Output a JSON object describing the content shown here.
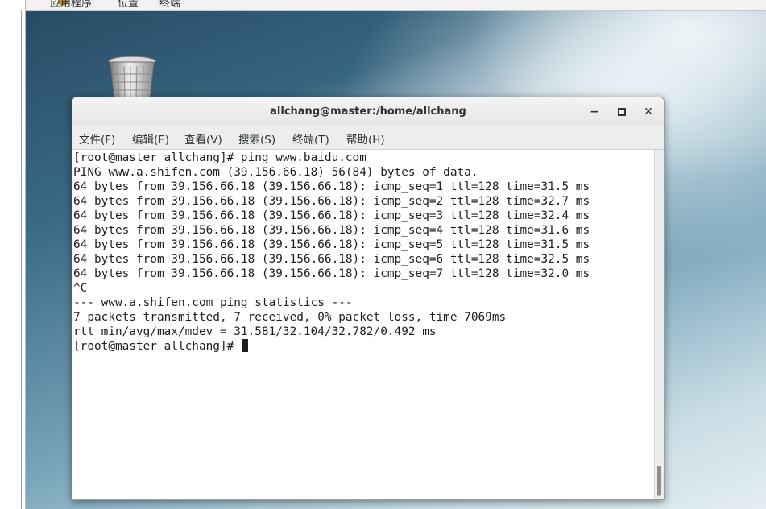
{
  "top_panel": {
    "applications": "应用程序",
    "places": "位置",
    "terminal": "终端"
  },
  "terminal": {
    "title": "allchang@master:/home/allchang",
    "controls": {
      "minimize": "−",
      "maximize": "▫",
      "close": "✕"
    },
    "menu": [
      "文件(F)",
      "编辑(E)",
      "查看(V)",
      "搜索(S)",
      "终端(T)",
      "帮助(H)"
    ],
    "lines": [
      "[root@master allchang]# ping www.baidu.com",
      "PING www.a.shifen.com (39.156.66.18) 56(84) bytes of data.",
      "64 bytes from 39.156.66.18 (39.156.66.18): icmp_seq=1 ttl=128 time=31.5 ms",
      "64 bytes from 39.156.66.18 (39.156.66.18): icmp_seq=2 ttl=128 time=32.7 ms",
      "64 bytes from 39.156.66.18 (39.156.66.18): icmp_seq=3 ttl=128 time=32.4 ms",
      "64 bytes from 39.156.66.18 (39.156.66.18): icmp_seq=4 ttl=128 time=31.6 ms",
      "64 bytes from 39.156.66.18 (39.156.66.18): icmp_seq=5 ttl=128 time=31.5 ms",
      "64 bytes from 39.156.66.18 (39.156.66.18): icmp_seq=6 ttl=128 time=32.5 ms",
      "64 bytes from 39.156.66.18 (39.156.66.18): icmp_seq=7 ttl=128 time=32.0 ms",
      "^C",
      "--- www.a.shifen.com ping statistics ---",
      "7 packets transmitted, 7 received, 0% packet loss, time 7069ms",
      "rtt min/avg/max/mdev = 31.581/32.104/32.782/0.492 ms"
    ],
    "prompt": "[root@master allchang]# "
  },
  "icons": {
    "trash": "trash-icon",
    "applications": "applications-icon"
  }
}
